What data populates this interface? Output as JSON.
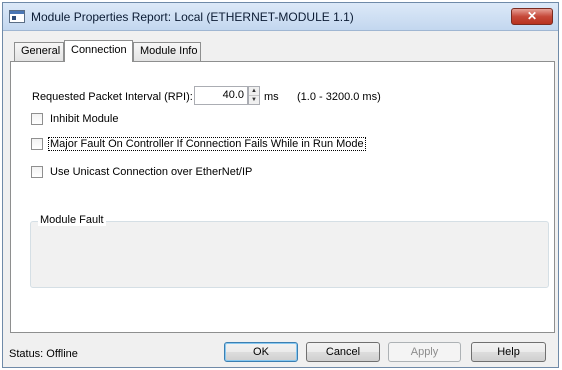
{
  "window": {
    "title": "Module Properties Report: Local (ETHERNET-MODULE 1.1)",
    "close_glyph": "✕"
  },
  "tabs": [
    {
      "label": "General",
      "active": false
    },
    {
      "label": "Connection",
      "active": true
    },
    {
      "label": "Module Info",
      "active": false
    }
  ],
  "connection": {
    "rpi_label": "Requested Packet Interval (RPI):",
    "rpi_value": "40.0",
    "rpi_unit": "ms",
    "rpi_range": "(1.0 - 3200.0 ms)",
    "checkboxes": [
      {
        "label": "Inhibit Module",
        "checked": false
      },
      {
        "label": "Major Fault On Controller If Connection Fails While in Run Mode",
        "checked": false,
        "focused": true
      },
      {
        "label": "Use Unicast Connection over EtherNet/IP",
        "checked": false
      }
    ],
    "fault_group_label": "Module Fault"
  },
  "footer": {
    "status": "Status:  Offline",
    "buttons": {
      "ok": "OK",
      "cancel": "Cancel",
      "apply": "Apply",
      "help": "Help"
    }
  },
  "icons": {
    "spin_up": "▲",
    "spin_down": "▼"
  }
}
